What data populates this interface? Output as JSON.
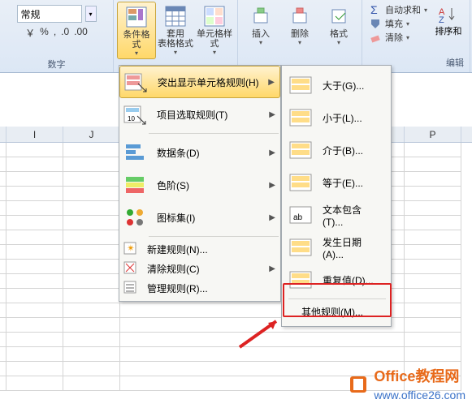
{
  "ribbon": {
    "number_group": {
      "label": "数字",
      "format": "常规",
      "currency_icon": "￥",
      "percent_icon": "%",
      "comma_icon": ",",
      "inc_dec_left": ".0",
      "inc_dec_right": ".00"
    },
    "styles_group": {
      "conditional_format": "条件格式",
      "table_format": "套用\n表格格式",
      "cell_styles": "单元格样式"
    },
    "cells_group": {
      "insert": "插入",
      "delete": "删除",
      "format": "格式"
    },
    "editing_group": {
      "label": "编辑",
      "autosum": "自动求和",
      "fill": "填充",
      "clear": "清除",
      "sort_filter": "排序和"
    }
  },
  "columns": {
    "i": "I",
    "j": "J",
    "p": "P"
  },
  "menu1": {
    "highlight_rules": "突出显示单元格规则(H)",
    "top_bottom": "项目选取规则(T)",
    "data_bars": "数据条(D)",
    "color_scales": "色阶(S)",
    "icon_sets": "图标集(I)",
    "new_rule": "新建规则(N)...",
    "clear_rules": "清除规则(C)",
    "manage_rules": "管理规则(R)..."
  },
  "menu2": {
    "greater": "大于(G)...",
    "less": "小于(L)...",
    "between": "介于(B)...",
    "equal": "等于(E)...",
    "text_contains": "文本包含(T)...",
    "date_occurring": "发生日期(A)...",
    "duplicate": "重复值(D)...",
    "other": "其他规则(M)..."
  },
  "watermark": {
    "brand": "Office",
    "suffix": "教程网",
    "url": "www.office26.com"
  }
}
